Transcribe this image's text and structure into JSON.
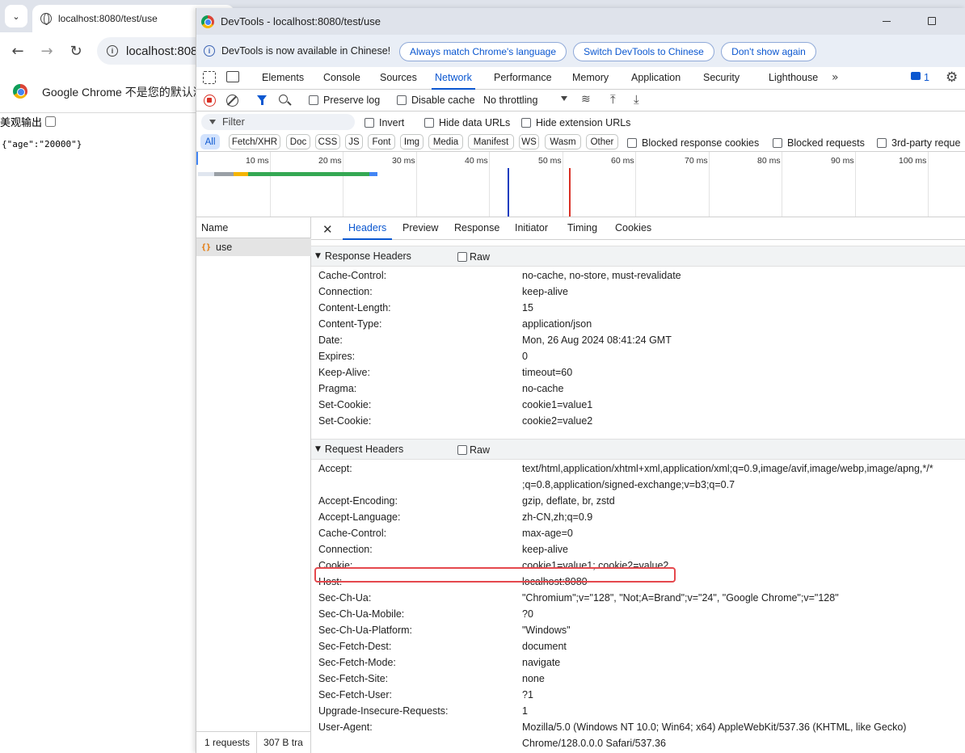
{
  "browser": {
    "tab_title": "localhost:8080/test/use",
    "url": "localhost:808",
    "banner_text": "Google Chrome 不是您的默认浏",
    "page_label": "美观输出",
    "page_json": "{\"age\":\"20000\"}"
  },
  "devtools": {
    "window_title": "DevTools - localhost:8080/test/use",
    "infobar": {
      "message": "DevTools is now available in Chinese!",
      "buttons": [
        "Always match Chrome's language",
        "Switch DevTools to Chinese",
        "Don't show again"
      ]
    },
    "tabs": [
      "Elements",
      "Console",
      "Sources",
      "Network",
      "Performance",
      "Memory",
      "Application",
      "Security",
      "Lighthouse"
    ],
    "active_tab": "Network",
    "issues_count": "1",
    "toolbar": {
      "preserve_log": "Preserve log",
      "disable_cache": "Disable cache",
      "throttling": "No throttling"
    },
    "filter": {
      "placeholder": "Filter",
      "invert": "Invert",
      "hide_data_urls": "Hide data URLs",
      "hide_extension_urls": "Hide extension URLs"
    },
    "types": [
      "All",
      "Fetch/XHR",
      "Doc",
      "CSS",
      "JS",
      "Font",
      "Img",
      "Media",
      "Manifest",
      "WS",
      "Wasm",
      "Other"
    ],
    "blocked_response_cookies": "Blocked response cookies",
    "blocked_requests": "Blocked requests",
    "third_party": "3rd-party reque",
    "timeline_ticks": [
      "10 ms",
      "20 ms",
      "30 ms",
      "40 ms",
      "50 ms",
      "60 ms",
      "70 ms",
      "80 ms",
      "90 ms",
      "100 ms"
    ],
    "name_column": "Name",
    "requests": [
      {
        "name": "use"
      }
    ],
    "status": {
      "requests": "1 requests",
      "transferred": "307 B tra"
    },
    "detail_tabs": [
      "Headers",
      "Preview",
      "Response",
      "Initiator",
      "Timing",
      "Cookies"
    ],
    "response_headers_title": "Response Headers",
    "request_headers_title": "Request Headers",
    "raw_label": "Raw",
    "response_headers": [
      {
        "k": "Cache-Control:",
        "v": "no-cache, no-store, must-revalidate"
      },
      {
        "k": "Connection:",
        "v": "keep-alive"
      },
      {
        "k": "Content-Length:",
        "v": "15"
      },
      {
        "k": "Content-Type:",
        "v": "application/json"
      },
      {
        "k": "Date:",
        "v": "Mon, 26 Aug 2024 08:41:24 GMT"
      },
      {
        "k": "Expires:",
        "v": "0"
      },
      {
        "k": "Keep-Alive:",
        "v": "timeout=60"
      },
      {
        "k": "Pragma:",
        "v": "no-cache"
      },
      {
        "k": "Set-Cookie:",
        "v": "cookie1=value1"
      },
      {
        "k": "Set-Cookie:",
        "v": "cookie2=value2"
      }
    ],
    "request_headers": [
      {
        "k": "Accept:",
        "v": "text/html,application/xhtml+xml,application/xml;q=0.9,image/avif,image/webp,image/apng,*/*",
        "v2": ";q=0.8,application/signed-exchange;v=b3;q=0.7"
      },
      {
        "k": "Accept-Encoding:",
        "v": "gzip, deflate, br, zstd"
      },
      {
        "k": "Accept-Language:",
        "v": "zh-CN,zh;q=0.9"
      },
      {
        "k": "Cache-Control:",
        "v": "max-age=0"
      },
      {
        "k": "Connection:",
        "v": "keep-alive"
      },
      {
        "k": "Cookie:",
        "v": "cookie1=value1; cookie2=value2"
      },
      {
        "k": "Host:",
        "v": "localhost:8080"
      },
      {
        "k": "Sec-Ch-Ua:",
        "v": "\"Chromium\";v=\"128\", \"Not;A=Brand\";v=\"24\", \"Google Chrome\";v=\"128\""
      },
      {
        "k": "Sec-Ch-Ua-Mobile:",
        "v": "?0"
      },
      {
        "k": "Sec-Ch-Ua-Platform:",
        "v": "\"Windows\""
      },
      {
        "k": "Sec-Fetch-Dest:",
        "v": "document"
      },
      {
        "k": "Sec-Fetch-Mode:",
        "v": "navigate"
      },
      {
        "k": "Sec-Fetch-Site:",
        "v": "none"
      },
      {
        "k": "Sec-Fetch-User:",
        "v": "?1"
      },
      {
        "k": "Upgrade-Insecure-Requests:",
        "v": "1"
      },
      {
        "k": "User-Agent:",
        "v": "Mozilla/5.0 (Windows NT 10.0; Win64; x64) AppleWebKit/537.36 (KHTML, like Gecko)",
        "v2": "Chrome/128.0.0.0 Safari/537.36"
      }
    ],
    "colors": {
      "accent": "#0b57d0",
      "record": "#d93025",
      "highlight": "#e5484d"
    }
  }
}
